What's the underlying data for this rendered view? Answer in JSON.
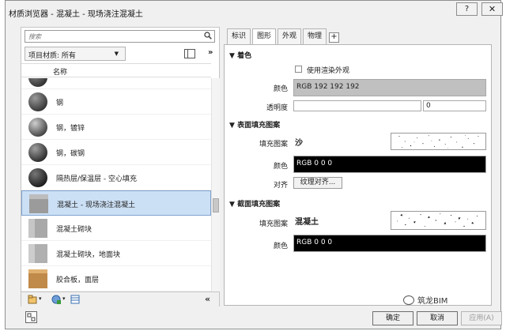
{
  "window": {
    "title": "材质浏览器 - 混凝土 - 现场浇注混凝土",
    "help_label": "?",
    "close_label": "✕"
  },
  "left": {
    "search_placeholder": "搜索",
    "search_icon": "search-icon",
    "library_label": "项目材质: 所有",
    "expand_label": "»",
    "column_header": "名称",
    "collapse_label": "«",
    "items": [
      {
        "label": "",
        "thumb": "#3a3a3a"
      },
      {
        "label": "钢",
        "thumb": "#4a4a4a"
      },
      {
        "label": "钢，镀锌",
        "thumb": "#6a6a6a"
      },
      {
        "label": "钢，碳钢",
        "thumb": "#3e3e3e"
      },
      {
        "label": "隔热层/保温层 - 空心填充",
        "thumb": "#2b2b2b"
      },
      {
        "label": "混凝土 - 现场浇注混凝土",
        "thumb": "#9b9b9b"
      },
      {
        "label": "混凝土砌块",
        "thumb": "#a8a8a8"
      },
      {
        "label": "混凝土砌块，地面块",
        "thumb": "#b0b0b0"
      },
      {
        "label": "胶合板，面层",
        "thumb": "#c08a4a"
      }
    ]
  },
  "tabs": [
    {
      "label": "标识"
    },
    {
      "label": "图形"
    },
    {
      "label": "外观"
    },
    {
      "label": "物理"
    },
    {
      "label": "+"
    }
  ],
  "graphics": {
    "shading": {
      "title": "着色",
      "use_render_label": "使用渲染外观",
      "color_label": "颜色",
      "color_value": "RGB 192 192 192",
      "transparency_label": "透明度",
      "transparency_value": "0"
    },
    "surface": {
      "title": "表面填充图案",
      "fill_label": "填充图案",
      "fill_value": "沙",
      "color_label": "颜色",
      "color_value": "RGB 0 0 0",
      "align_label": "对齐",
      "align_button": "纹理对齐..."
    },
    "cut": {
      "title": "截面填充图案",
      "fill_label": "填充图案",
      "fill_value": "混凝土",
      "color_label": "颜色",
      "color_value": "RGB 0 0 0"
    }
  },
  "footer": {
    "ok_label": "确定",
    "cancel_label": "取消",
    "apply_label": "应用(A)",
    "watermark": "筑龙BIM"
  }
}
